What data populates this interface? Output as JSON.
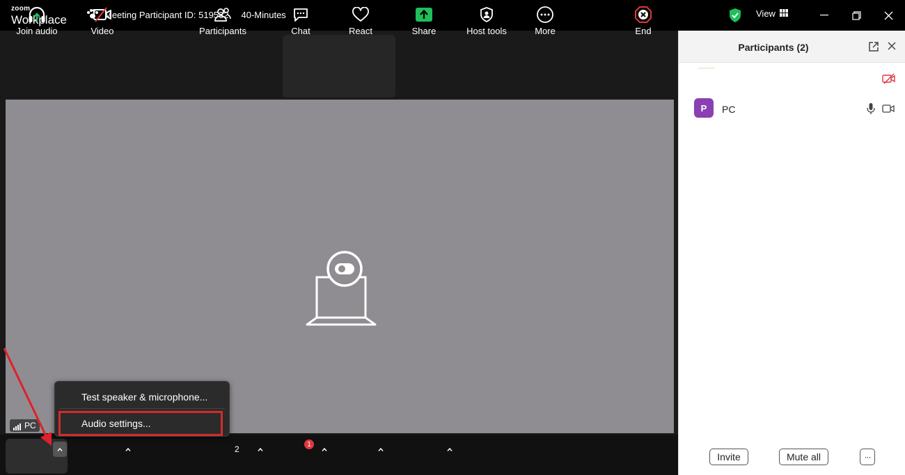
{
  "titlebar": {
    "logo_top": "zoom",
    "logo_bottom": "Workplace",
    "meeting_id": "Meeting Participant ID: 519532",
    "duration": "40-Minutes",
    "view_label": "View"
  },
  "video": {
    "participant_tag": "PC"
  },
  "audio_menu": {
    "items": [
      "Test speaker & microphone...",
      "Audio settings..."
    ]
  },
  "toolbar": {
    "join_audio": "Join audio",
    "video": "Video",
    "participants": "Participants",
    "participant_count": "2",
    "chat": "Chat",
    "chat_badge": "1",
    "react": "React",
    "share": "Share",
    "host_tools": "Host tools",
    "more": "More",
    "end": "End"
  },
  "panel": {
    "title": "Participants (2)",
    "participants": [
      {
        "initial": "P",
        "name": "PC"
      }
    ],
    "invite": "Invite",
    "mute_all": "Mute all",
    "more_glyph": "···"
  },
  "colors": {
    "accent_green": "#1fbf5a",
    "avatar_purple": "#8a3fb3",
    "annotation_red": "#d42b2b",
    "end_red": "#e0373c"
  }
}
